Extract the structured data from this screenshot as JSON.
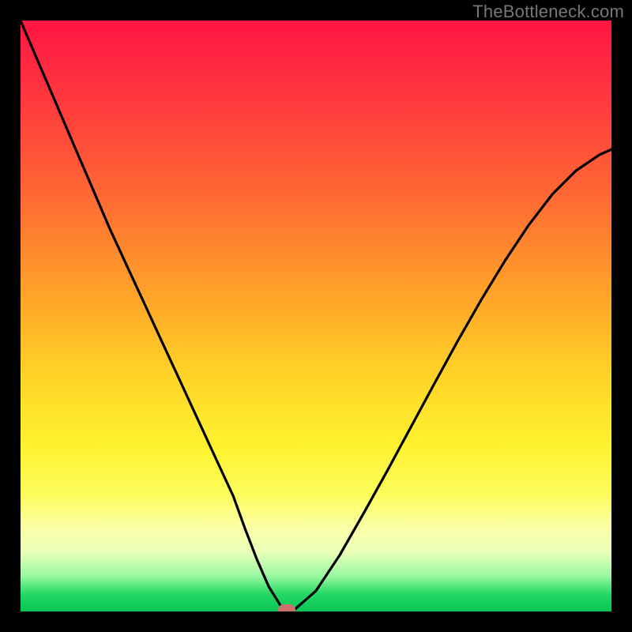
{
  "watermark": "TheBottleneck.com",
  "chart_data": {
    "type": "line",
    "title": "",
    "xlabel": "",
    "ylabel": "",
    "xlim": [
      0,
      100
    ],
    "ylim": [
      0,
      100
    ],
    "grid": false,
    "legend": false,
    "series": [
      {
        "name": "bottleneck-curve",
        "x": [
          0,
          3,
          6,
          9,
          12,
          15,
          18,
          21,
          24,
          27,
          30,
          33,
          36,
          38,
          40,
          42,
          44,
          46,
          50,
          54,
          58,
          62,
          66,
          70,
          74,
          78,
          82,
          86,
          90,
          94,
          98,
          100
        ],
        "y": [
          100,
          93,
          86,
          79,
          72,
          65,
          58.5,
          52,
          45.5,
          39,
          32.5,
          26,
          19.5,
          14,
          8.8,
          4.2,
          1.0,
          0.0,
          3.5,
          9.5,
          16.5,
          23.7,
          31.1,
          38.5,
          45.8,
          52.8,
          59.4,
          65.4,
          70.6,
          74.6,
          77.3,
          78.2
        ]
      }
    ],
    "marker": {
      "x": 45,
      "y": 0.3
    },
    "gradient_stops": [
      {
        "pos": 0,
        "color": "#ff1543"
      },
      {
        "pos": 14,
        "color": "#ff3a3e"
      },
      {
        "pos": 30,
        "color": "#ff6a33"
      },
      {
        "pos": 46,
        "color": "#ffa229"
      },
      {
        "pos": 60,
        "color": "#ffd327"
      },
      {
        "pos": 72,
        "color": "#fff22f"
      },
      {
        "pos": 80,
        "color": "#fcfd5b"
      },
      {
        "pos": 86,
        "color": "#fbffa8"
      },
      {
        "pos": 90,
        "color": "#e9ffb7"
      },
      {
        "pos": 94,
        "color": "#99f9a1"
      },
      {
        "pos": 97,
        "color": "#26d965"
      },
      {
        "pos": 100,
        "color": "#05c455"
      }
    ]
  }
}
